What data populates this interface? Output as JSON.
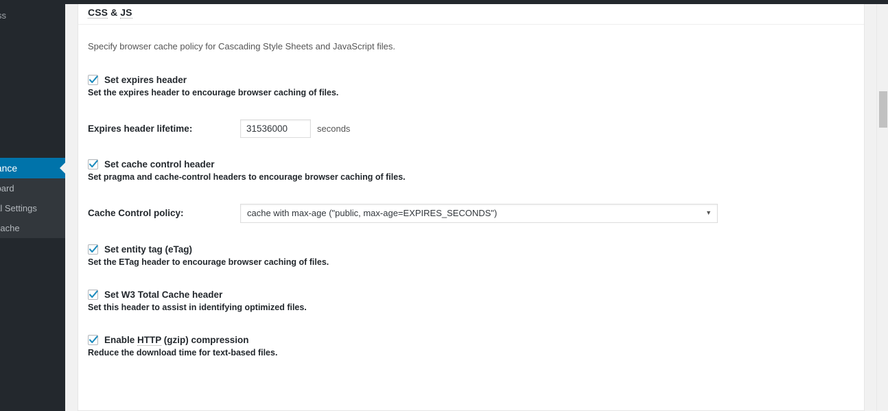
{
  "sidebar": {
    "brand": "WordPress",
    "current_item": "Performance",
    "sub_items": [
      {
        "label": "Dashboard"
      },
      {
        "label": "General Settings"
      },
      {
        "label": "Page Cache"
      }
    ]
  },
  "panel": {
    "title_parts": {
      "css": "CSS",
      "amp": "&",
      "js": "JS"
    },
    "intro": "Specify browser cache policy for Cascading Style Sheets and JavaScript files.",
    "sections": [
      {
        "id": "expires",
        "checkbox_label": "Set expires header",
        "checked": true,
        "description": "Set the expires header to encourage browser caching of files.",
        "control": {
          "type": "text",
          "label": "Expires header lifetime:",
          "value": "31536000",
          "placeholder": "",
          "suffix": "seconds"
        }
      },
      {
        "id": "cache-control",
        "checkbox_label": "Set cache control header",
        "checked": true,
        "description": "Set pragma and cache-control headers to encourage browser caching of files.",
        "control": {
          "type": "select",
          "label": "Cache Control policy:",
          "value": "cache with max-age (\"public, max-age=EXPIRES_SECONDS\")",
          "caret": "▼"
        }
      },
      {
        "id": "etag",
        "checkbox_label_prefix": "Set entity tag (",
        "checkbox_label_abbr": "eTag",
        "checkbox_label_suffix": ")",
        "checked": true,
        "description": "Set the ETag header to encourage browser caching of files."
      },
      {
        "id": "w3tc-header",
        "checkbox_label": "Set W3 Total Cache header",
        "checked": true,
        "description": "Set this header to assist in identifying optimized files."
      },
      {
        "id": "gzip",
        "checkbox_label_prefix": "Enable ",
        "checkbox_label_abbr": "HTTP",
        "checkbox_label_suffix": " (gzip) compression",
        "checked": true,
        "description": "Reduce the download time for text-based files."
      }
    ]
  },
  "colors": {
    "accent": "#0073aa",
    "sidebar_bg": "#23282d",
    "sidebar_sub_bg": "#32373c",
    "check_blue": "#1e8cbe",
    "panel_bg": "#ffffff",
    "page_bg": "#f1f1f1",
    "scroll_thumb": "#c1c1c1"
  }
}
